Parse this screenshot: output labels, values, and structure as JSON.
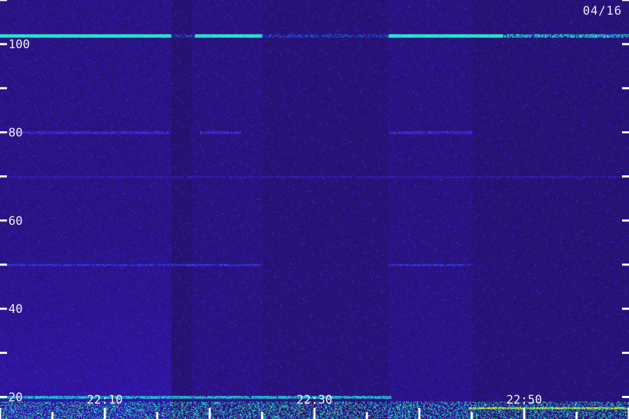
{
  "date_label": "04/16",
  "chart_data": {
    "type": "heatmap",
    "title": "",
    "xlabel": "",
    "ylabel": "",
    "x_tick_labels": [
      "22:10",
      "22:30",
      "22:50"
    ],
    "y_tick_labels": [
      "20",
      "40",
      "60",
      "80",
      "100"
    ],
    "ylim": [
      15,
      110
    ],
    "grid": false,
    "colormap": [
      "#1a0a40",
      "#2a10a0",
      "#2a4cff",
      "#00c8ff",
      "#30ff80",
      "#d0ff20"
    ],
    "background_color": "#1e0f4a",
    "features": [
      {
        "kind": "horizontal_band",
        "y": 102,
        "intensity": "strong",
        "color": "#30e0c0"
      },
      {
        "kind": "horizontal_band",
        "y": 80,
        "intensity": "weak",
        "color": "#4a2ad0"
      },
      {
        "kind": "horizontal_band",
        "y": 70,
        "intensity": "weak",
        "color": "#3a20b0"
      },
      {
        "kind": "horizontal_band",
        "y": 50,
        "intensity": "weak",
        "color": "#3a2ae0"
      },
      {
        "kind": "horizontal_band",
        "y": 20,
        "intensity": "medium",
        "color": "#20d0e0"
      },
      {
        "kind": "broadband_region",
        "y_range": [
          15,
          60
        ],
        "intensity": "medium",
        "color": "#2a4cff"
      },
      {
        "kind": "low_frequency_noise",
        "y_range": [
          15,
          19
        ],
        "intensity": "strong",
        "color": "#30ff80"
      }
    ]
  }
}
